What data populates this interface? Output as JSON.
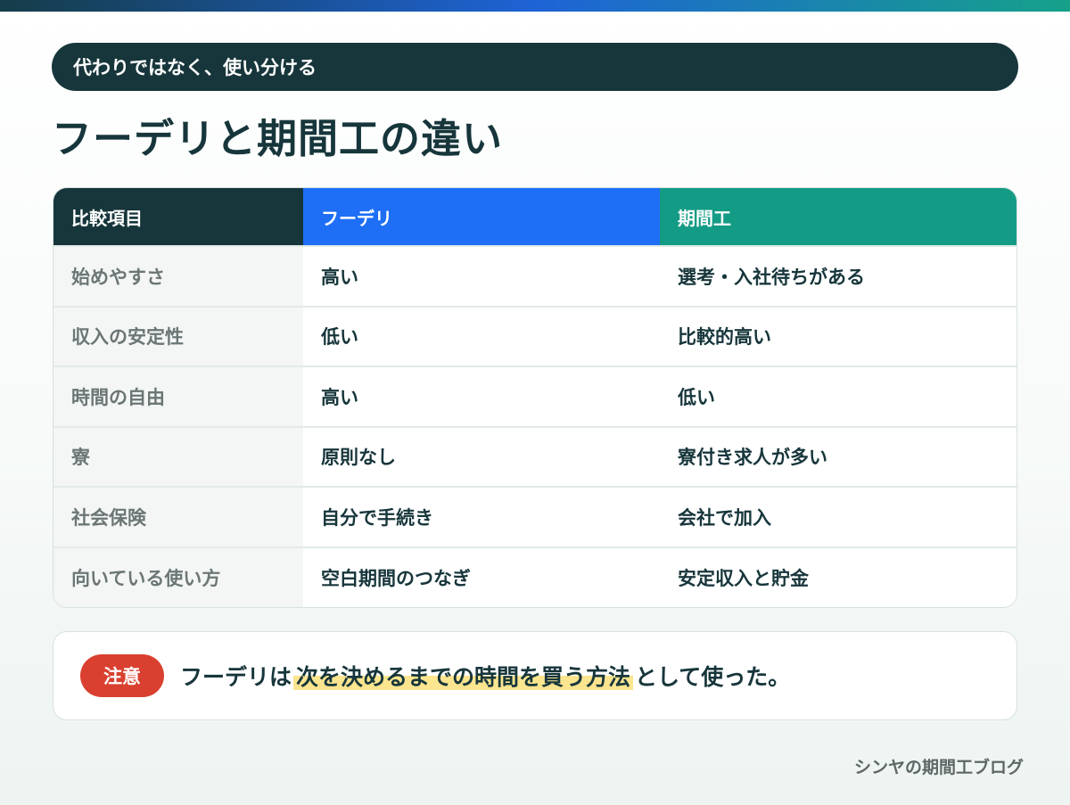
{
  "banner": {
    "label": "代わりではなく、使い分ける"
  },
  "title": "フーデリと期間工の違い",
  "table": {
    "headers": [
      "比較項目",
      "フーデリ",
      "期間工"
    ],
    "rows": [
      [
        "始めやすさ",
        "高い",
        "選考・入社待ちがある"
      ],
      [
        "収入の安定性",
        "低い",
        "比較的高い"
      ],
      [
        "時間の自由",
        "高い",
        "低い"
      ],
      [
        "寮",
        "原則なし",
        "寮付き求人が多い"
      ],
      [
        "社会保険",
        "自分で手続き",
        "会社で加入"
      ],
      [
        "向いている使い方",
        "空白期間のつなぎ",
        "安定収入と貯金"
      ]
    ]
  },
  "note": {
    "badge": "注意",
    "text_before": "フーデリは",
    "highlight": "次を決めるまでの時間を買う方法",
    "text_after": "として使った。"
  },
  "footer": {
    "blog_name": "シンヤの期間工ブログ"
  },
  "colors": {
    "dark": "#17363b",
    "fudeli_blue": "#1e6ff5",
    "kikanko_green": "#149b85",
    "badge_red": "#d9402f",
    "highlight_yellow": "#fbe58f"
  }
}
